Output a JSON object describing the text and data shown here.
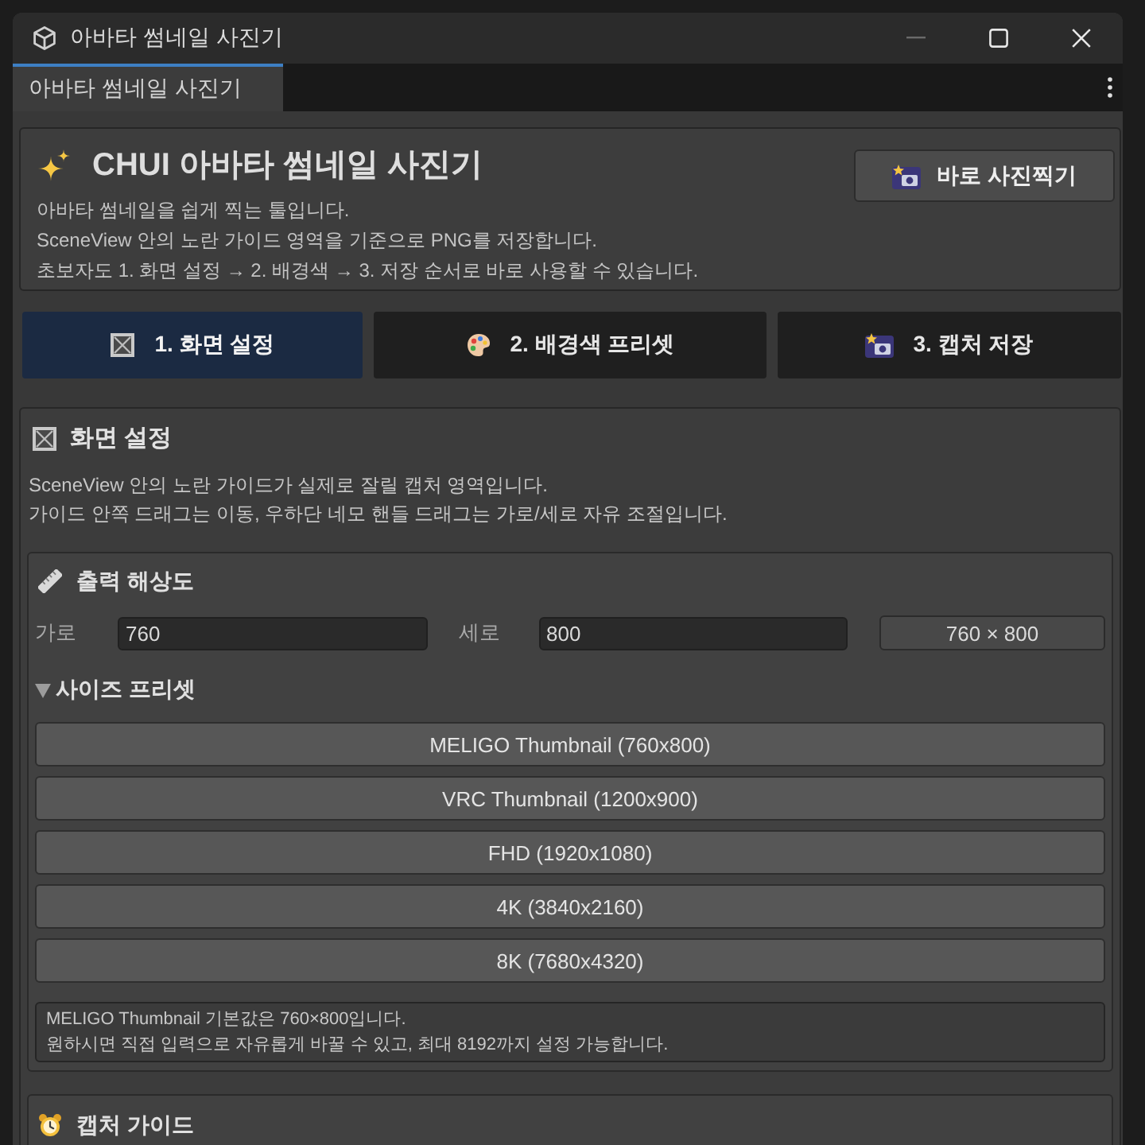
{
  "window": {
    "title": "아바타 썸네일 사진기"
  },
  "editor_tabs": [
    {
      "label": "아바타 썸네일 사진기",
      "selected": true
    }
  ],
  "header": {
    "title": "CHUI 아바타 썸네일 사진기",
    "lines": [
      "아바타 썸네일을 쉽게 찍는 툴입니다.",
      "SceneView 안의 노란 가이드 영역을 기준으로 PNG를 저장합니다.",
      "초보자도 1. 화면 설정 → 2. 배경색 → 3. 저장 순서로 바로 사용할 수 있습니다."
    ],
    "action_button": "바로 사진찍기"
  },
  "steps": [
    {
      "label": "1. 화면 설정",
      "selected": true
    },
    {
      "label": "2. 배경색 프리셋",
      "selected": false
    },
    {
      "label": "3. 캡처 저장",
      "selected": false
    }
  ],
  "screen_settings": {
    "title": "화면 설정",
    "lines": [
      "SceneView 안의 노란 가이드가 실제로 잘릴 캡처 영역입니다.",
      "가이드 안쪽 드래그는 이동, 우하단 네모 핸들 드래그는 가로/세로 자유 조절입니다."
    ],
    "resolution": {
      "title": "출력 해상도",
      "fields": [
        {
          "label": "가로",
          "value": "760"
        },
        {
          "label": "세로",
          "value": "800"
        }
      ],
      "summary": "760 × 800",
      "presets": {
        "title": "사이즈 프리셋",
        "expanded": true,
        "items": [
          "MELIGO Thumbnail (760x800)",
          "VRC Thumbnail (1200x900)",
          "FHD (1920x1080)",
          "4K (3840x2160)",
          "8K (7680x4320)"
        ]
      },
      "note": [
        "MELIGO Thumbnail 기본값은 760×800입니다.",
        "원하시면 직접 입력으로 자유롭게 바꿀 수 있고, 최대 8192까지 설정 가능합니다."
      ]
    },
    "capture_guide": {
      "title": "캡처 가이드"
    }
  }
}
